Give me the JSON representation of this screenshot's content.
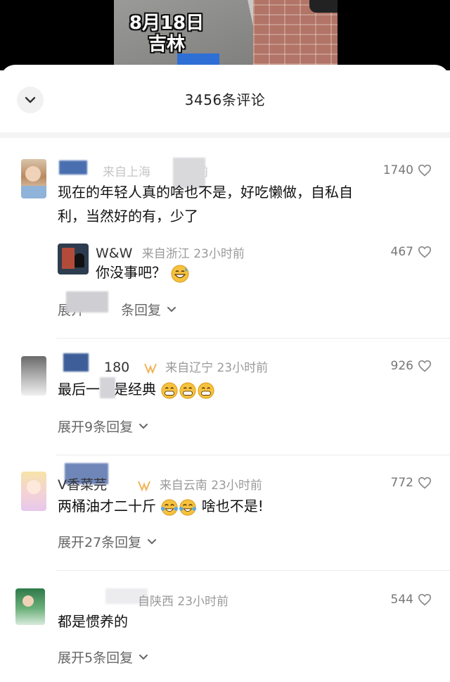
{
  "video": {
    "caption_line1": "8月18日",
    "caption_line2": "吉林"
  },
  "header": {
    "title": "3456条评论",
    "collapse_icon": "chevron-down-icon"
  },
  "comments": [
    {
      "username": "",
      "location_time": "来自上海",
      "time_partial": "前",
      "likes": "1740",
      "text_line1": "现在的年轻人真的啥也不是，好吃懒做，自私自",
      "text_line2": "利，当然好的有，少了",
      "reply": {
        "username": "W&W",
        "meta": "来自浙江 23小时前",
        "likes": "467",
        "text": "你没事吧？"
      },
      "expand_label": "展开",
      "expand_suffix": "条回复"
    },
    {
      "username": "180",
      "meta": "来自辽宁 23小时前",
      "likes": "926",
      "text": "最后一",
      "text_tail": "是经典",
      "expand_label": "展开9条回复"
    },
    {
      "username": "V香菜芫",
      "meta": "来自云南 23小时前",
      "likes": "772",
      "text_a": "两桶油才二十斤",
      "text_b": "啥也不是!",
      "expand_label": "展开27条回复"
    },
    {
      "meta": "来自陕西 23小时前",
      "meta_partial": "自陕西 23小时前",
      "likes": "544",
      "text": "都是惯养的",
      "expand_label": "展开5条回复"
    }
  ],
  "icons": {
    "like": "heart-outline-icon",
    "expand": "chevron-down-icon"
  }
}
